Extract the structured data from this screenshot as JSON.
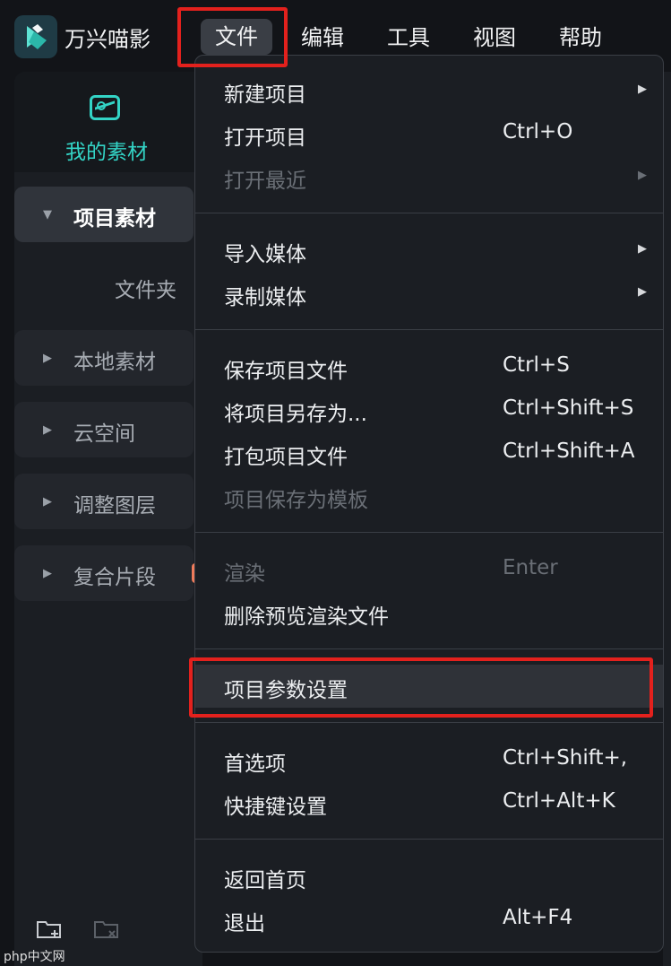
{
  "app": {
    "name": "万兴喵影",
    "logo_icon": "app-logo-icon"
  },
  "menubar": [
    "文件",
    "编辑",
    "工具",
    "视图",
    "帮助"
  ],
  "media_tab": {
    "label": "我的素材",
    "icon": "media-icon",
    "accent": "#33d4c6"
  },
  "tree": {
    "items": [
      "项目素材",
      "本地素材",
      "云空间",
      "调整图层",
      "复合片段"
    ],
    "folder": "文件夹"
  },
  "file_menu": {
    "groups": [
      [
        {
          "label": "新建项目",
          "shortcut": "",
          "submenu": true,
          "disabled": false
        },
        {
          "label": "打开项目",
          "shortcut": "Ctrl+O",
          "submenu": false,
          "disabled": false
        },
        {
          "label": "打开最近",
          "shortcut": "",
          "submenu": true,
          "disabled": true
        }
      ],
      [
        {
          "label": "导入媒体",
          "shortcut": "",
          "submenu": true,
          "disabled": false
        },
        {
          "label": "录制媒体",
          "shortcut": "",
          "submenu": true,
          "disabled": false
        }
      ],
      [
        {
          "label": "保存项目文件",
          "shortcut": "Ctrl+S",
          "submenu": false,
          "disabled": false
        },
        {
          "label": "将项目另存为...",
          "shortcut": "Ctrl+Shift+S",
          "submenu": false,
          "disabled": false
        },
        {
          "label": "打包项目文件",
          "shortcut": "Ctrl+Shift+A",
          "submenu": false,
          "disabled": false
        },
        {
          "label": "项目保存为模板",
          "shortcut": "",
          "submenu": false,
          "disabled": true
        }
      ],
      [
        {
          "label": "渲染",
          "shortcut": "Enter",
          "submenu": false,
          "disabled": true
        },
        {
          "label": "删除预览渲染文件",
          "shortcut": "",
          "submenu": false,
          "disabled": false
        }
      ],
      [
        {
          "label": "项目参数设置",
          "shortcut": "",
          "submenu": false,
          "disabled": false,
          "highlighted": true
        }
      ],
      [
        {
          "label": "首选项",
          "shortcut": "Ctrl+Shift+,",
          "submenu": false,
          "disabled": false
        },
        {
          "label": "快捷键设置",
          "shortcut": "Ctrl+Alt+K",
          "submenu": false,
          "disabled": false
        }
      ],
      [
        {
          "label": "返回首页",
          "shortcut": "",
          "submenu": false,
          "disabled": false
        },
        {
          "label": "退出",
          "shortcut": "Alt+F4",
          "submenu": false,
          "disabled": false
        }
      ]
    ]
  },
  "bottom_icons": [
    "new-folder-icon",
    "delete-folder-icon"
  ],
  "watermark": "php中文网",
  "colors": {
    "highlight_border": "#e3211d",
    "accent": "#33d4c6",
    "background": "#121418"
  }
}
